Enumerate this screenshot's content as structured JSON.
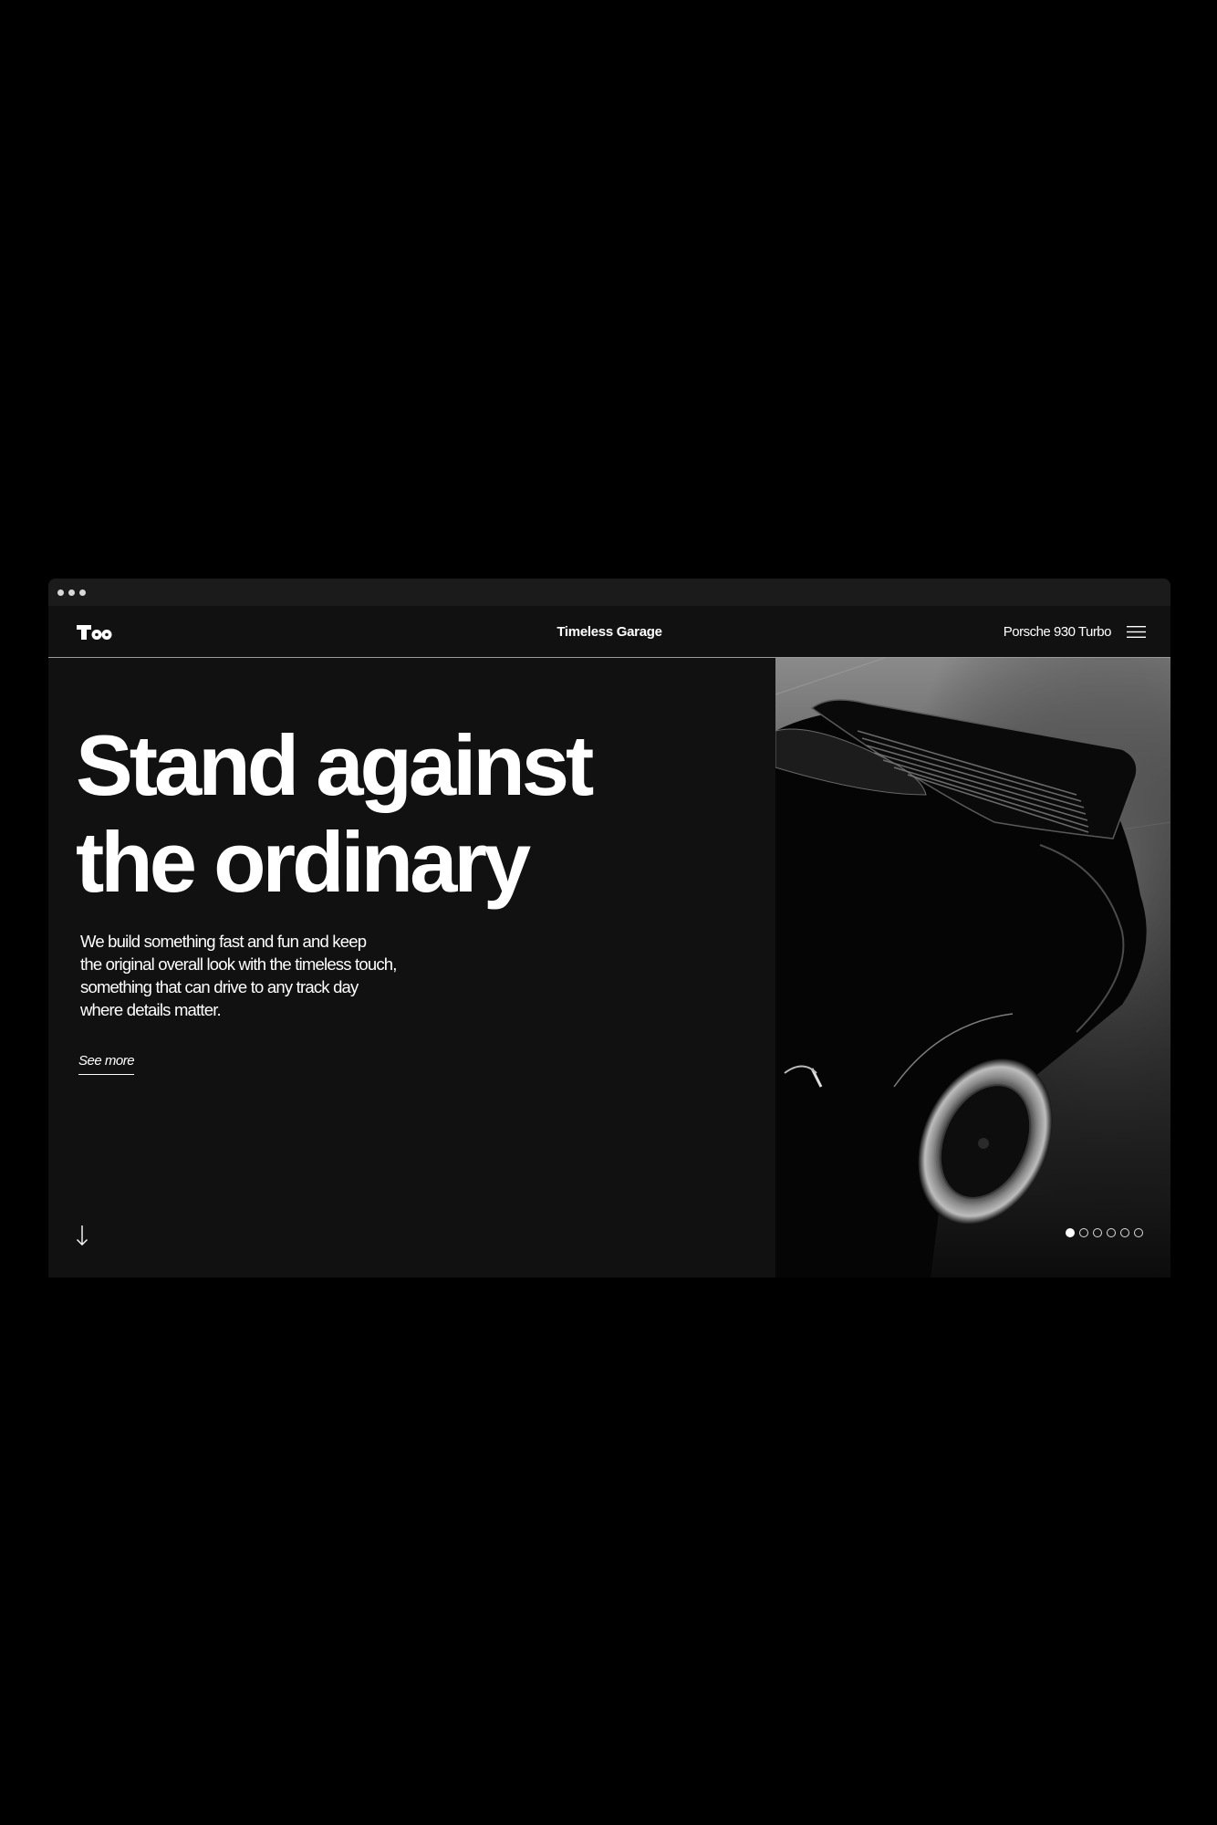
{
  "header": {
    "brand": "Timeless Garage",
    "model": "Porsche 930 Turbo",
    "logo_text": "Too",
    "menu_icon": "hamburger-menu-icon"
  },
  "hero": {
    "headline_line1": "Stand against",
    "headline_line2": "the ordinary",
    "tagline": [
      "We build something fast and fun and keep",
      "the original overall look with the timeless touch,",
      "something that can drive to any track day",
      "where details matter."
    ],
    "see_more": "See more",
    "scroll_icon": "arrow-down-icon"
  },
  "slider": {
    "total_slides": 6,
    "active_slide": 1
  },
  "colors": {
    "background": "#000000",
    "panel": "#111111",
    "text": "#ffffff",
    "divider": "#9a9a9a"
  }
}
